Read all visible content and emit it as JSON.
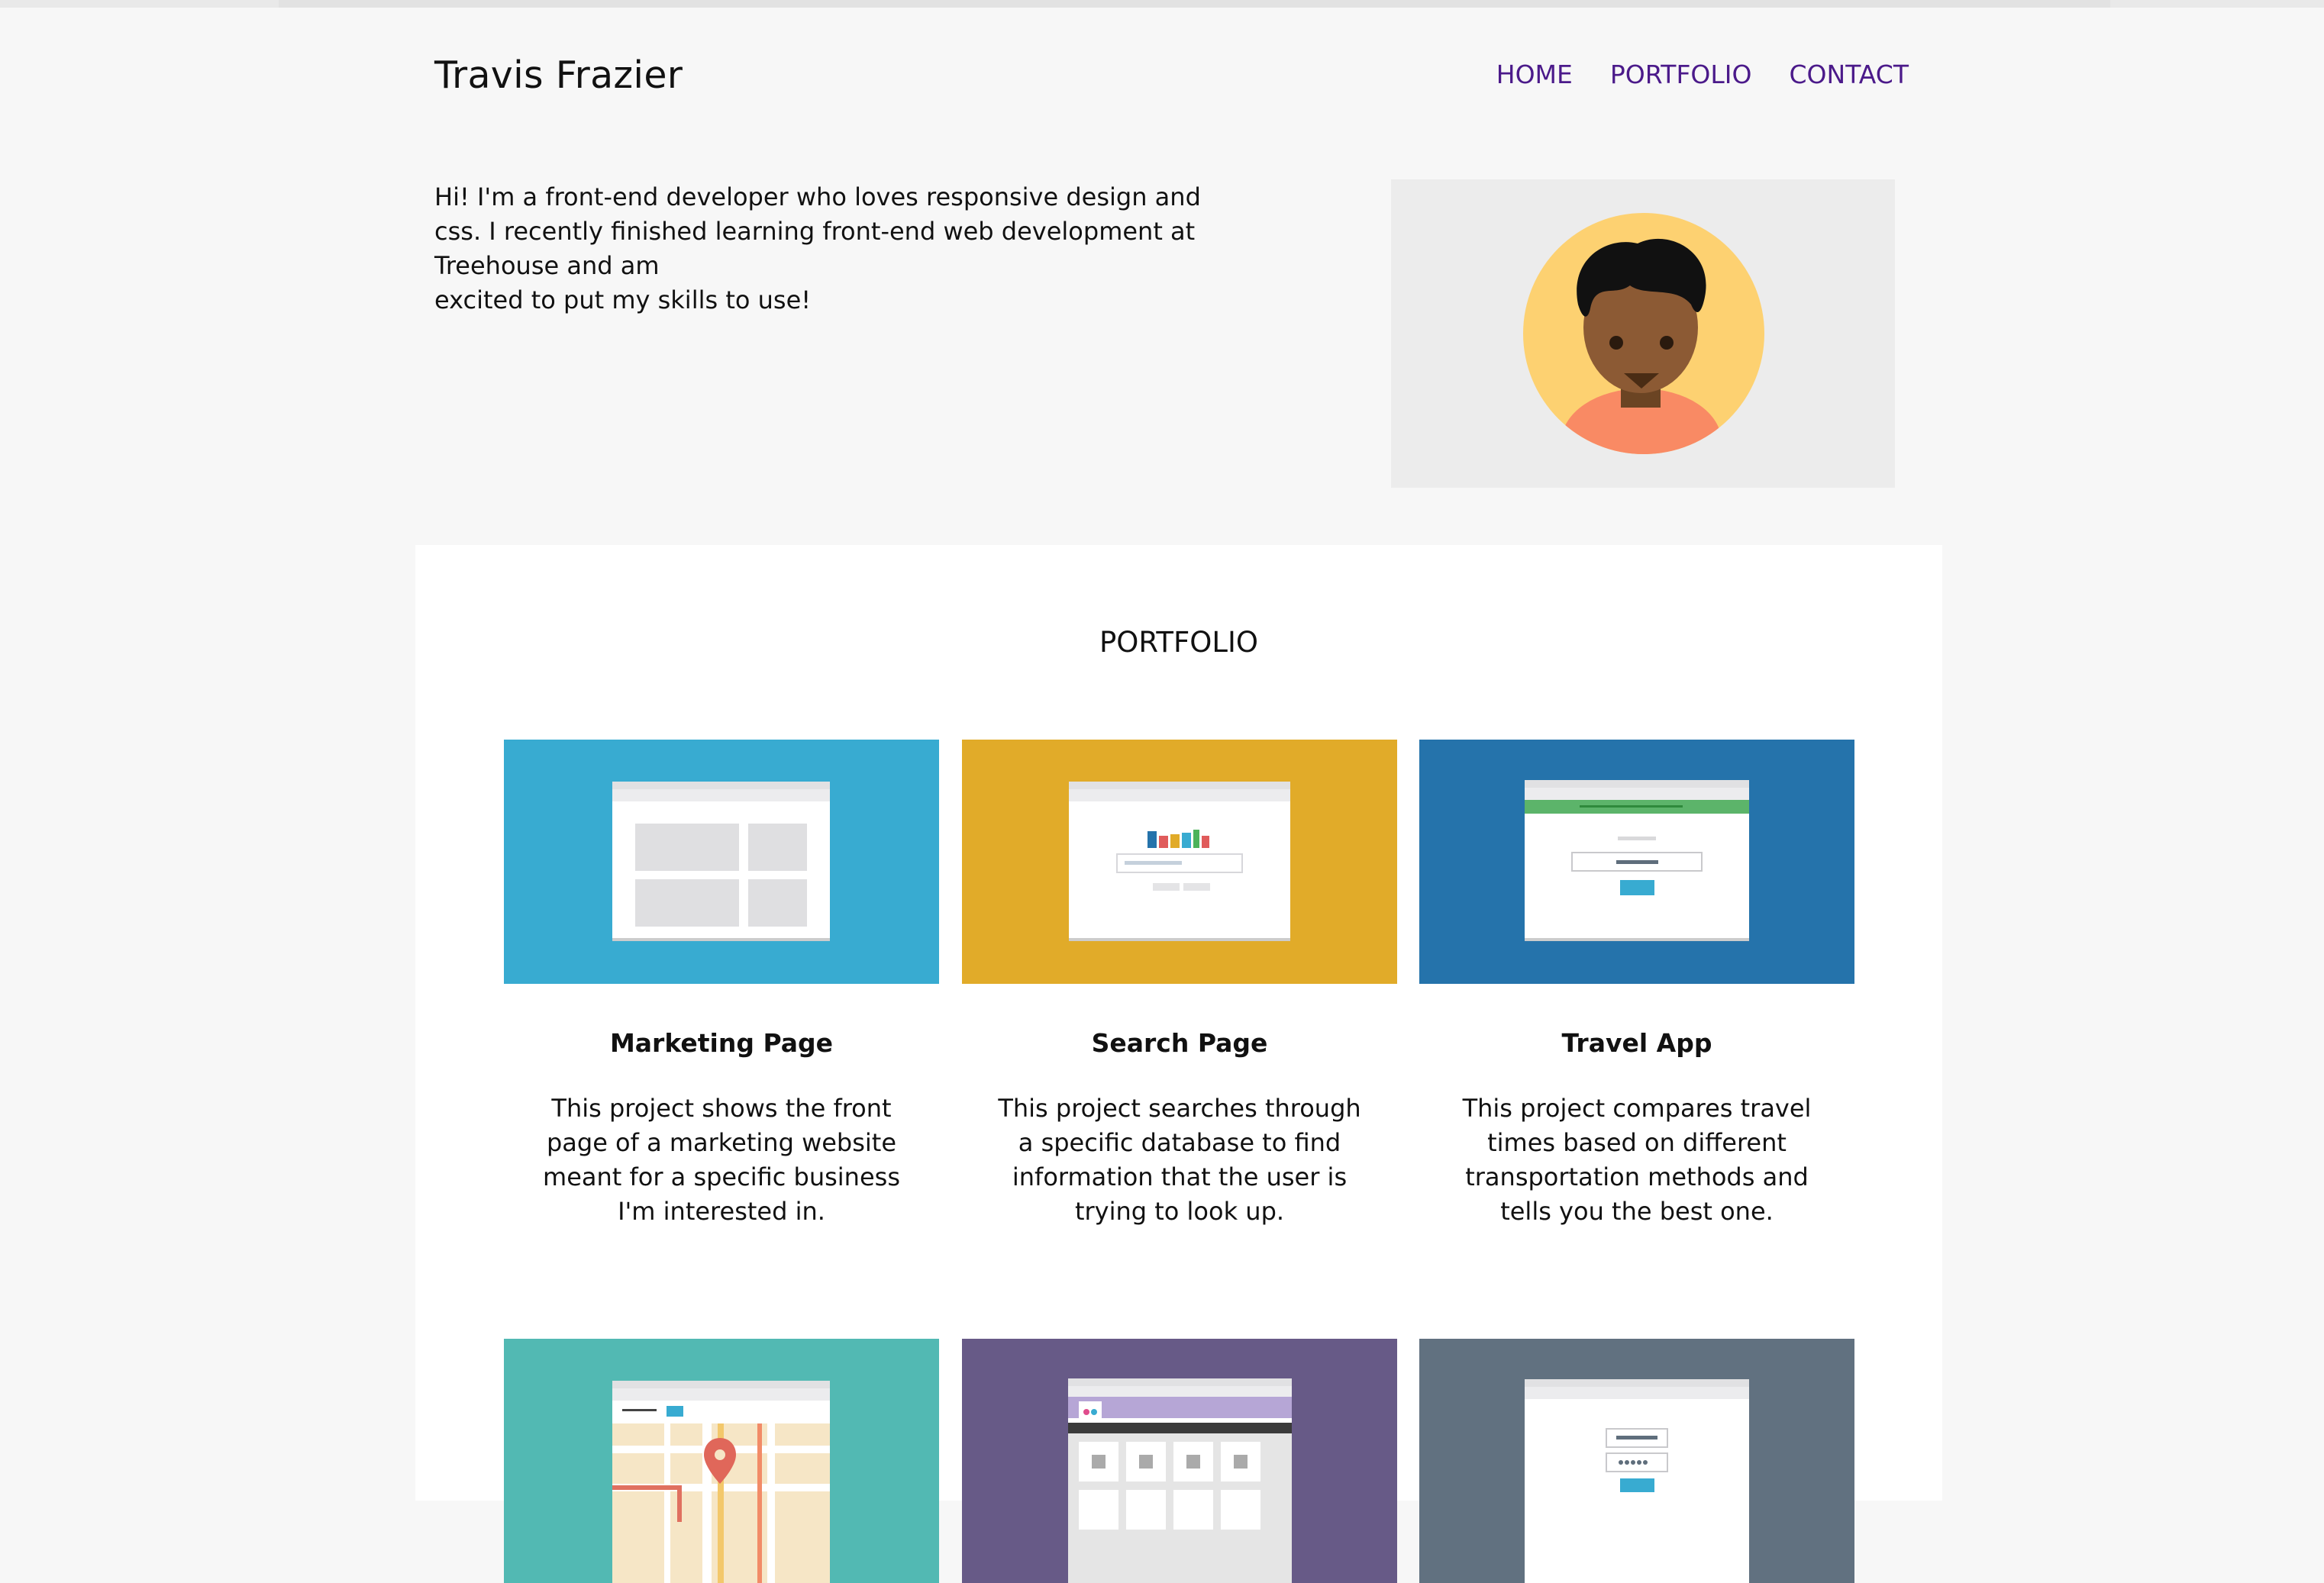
{
  "header": {
    "title": "Travis Frazier"
  },
  "nav": {
    "items": [
      "HOME",
      "PORTFOLIO",
      "CONTACT"
    ]
  },
  "intro": {
    "lines": [
      "Hi! I'm a front-end developer who loves responsive design and",
      "css. I recently finished learning front-end web development at",
      "Treehouse and am",
      "excited to put my skills to use!"
    ]
  },
  "portfolio": {
    "heading": "PORTFOLIO",
    "projects": [
      {
        "title": "Marketing Page",
        "description": "This project shows the front page of a marketing website meant for a specific business I'm interested in.",
        "color": "#38abd1"
      },
      {
        "title": "Search Page",
        "description": "This project searches through a specific database to find information that the user is trying to look up.",
        "color": "#e1ab29"
      },
      {
        "title": "Travel App",
        "description": "This project compares travel times based on different transportation methods and tells you the best one.",
        "color": "#2573ab"
      },
      {
        "title": "",
        "description": "",
        "color": "#52b9b3"
      },
      {
        "title": "",
        "description": "",
        "color": "#675a87"
      },
      {
        "title": "",
        "description": "",
        "color": "#617180"
      }
    ]
  },
  "icons": {
    "avatar": "avatar-illustration"
  }
}
